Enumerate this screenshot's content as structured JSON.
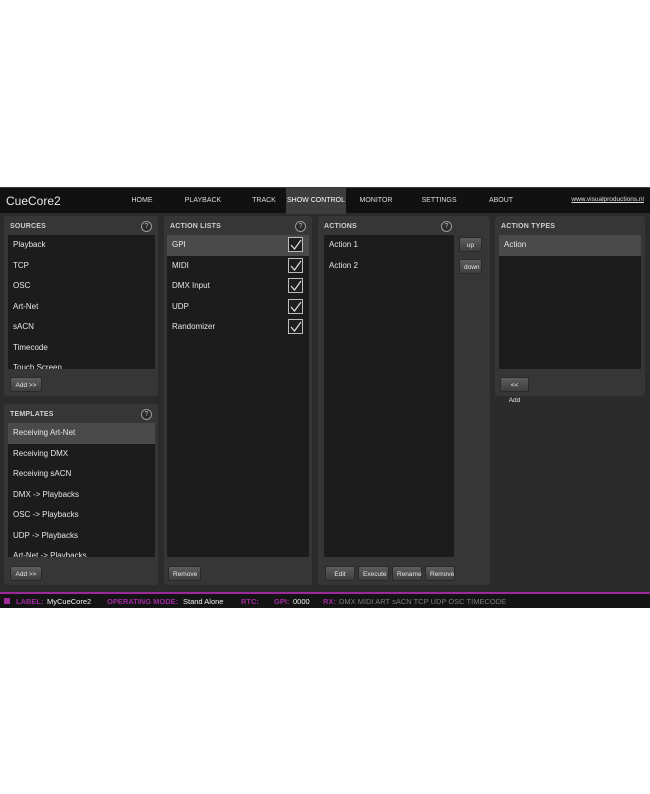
{
  "app": {
    "title": "CueCore2",
    "site_link": "www.visualproductions.nl"
  },
  "nav": {
    "items": [
      "HOME",
      "PLAYBACK",
      "TRACK",
      "SHOW CONTROL",
      "MONITOR",
      "SETTINGS",
      "ABOUT"
    ],
    "active": "SHOW CONTROL"
  },
  "sources": {
    "title": "SOURCES",
    "items": [
      "Playback",
      "TCP",
      "OSC",
      "Art-Net",
      "sACN",
      "Timecode",
      "Touch Screen"
    ],
    "add_label": "Add >>"
  },
  "templates": {
    "title": "TEMPLATES",
    "items": [
      "Receiving Art-Net",
      "Receiving DMX",
      "Receiving sACN",
      "DMX -> Playbacks",
      "OSC -> Playbacks",
      "UDP -> Playbacks",
      "Art-Net -> Playbacks"
    ],
    "selected": "Receiving Art-Net",
    "add_label": "Add >>"
  },
  "action_lists": {
    "title": "ACTION LISTS",
    "items": [
      {
        "label": "GPI",
        "checked": true
      },
      {
        "label": "MIDI",
        "checked": true
      },
      {
        "label": "DMX Input",
        "checked": true
      },
      {
        "label": "UDP",
        "checked": true
      },
      {
        "label": "Randomizer",
        "checked": true
      }
    ],
    "selected": "GPI",
    "remove_label": "Remove"
  },
  "actions": {
    "title": "ACTIONS",
    "items": [
      "Action 1",
      "Action 2"
    ],
    "up_label": "up",
    "down_label": "down",
    "edit_label": "Edit",
    "execute_label": "Execute",
    "rename_label": "Rename",
    "remove_label": "Remove"
  },
  "action_types": {
    "title": "ACTION TYPES",
    "items": [
      "Action"
    ],
    "selected": "Action",
    "add_label": "<< Add"
  },
  "help_glyph": "?",
  "status": {
    "label_key": "LABEL:",
    "label_value": "MyCueCore2",
    "mode_key": "OPERATING MODE:",
    "mode_value": "Stand Alone",
    "rtc_key": "RTC:",
    "gpi_key": "GPI:",
    "gpi_value": "0000",
    "rx_key": "RX:",
    "rx_items": "DMX MIDI ART sACN TCP UDP OSC TIMECODE"
  },
  "colors": {
    "accent": "#a02aa0",
    "background": "#2b2b2b",
    "panel": "#363636",
    "list": "#1c1c1c"
  }
}
